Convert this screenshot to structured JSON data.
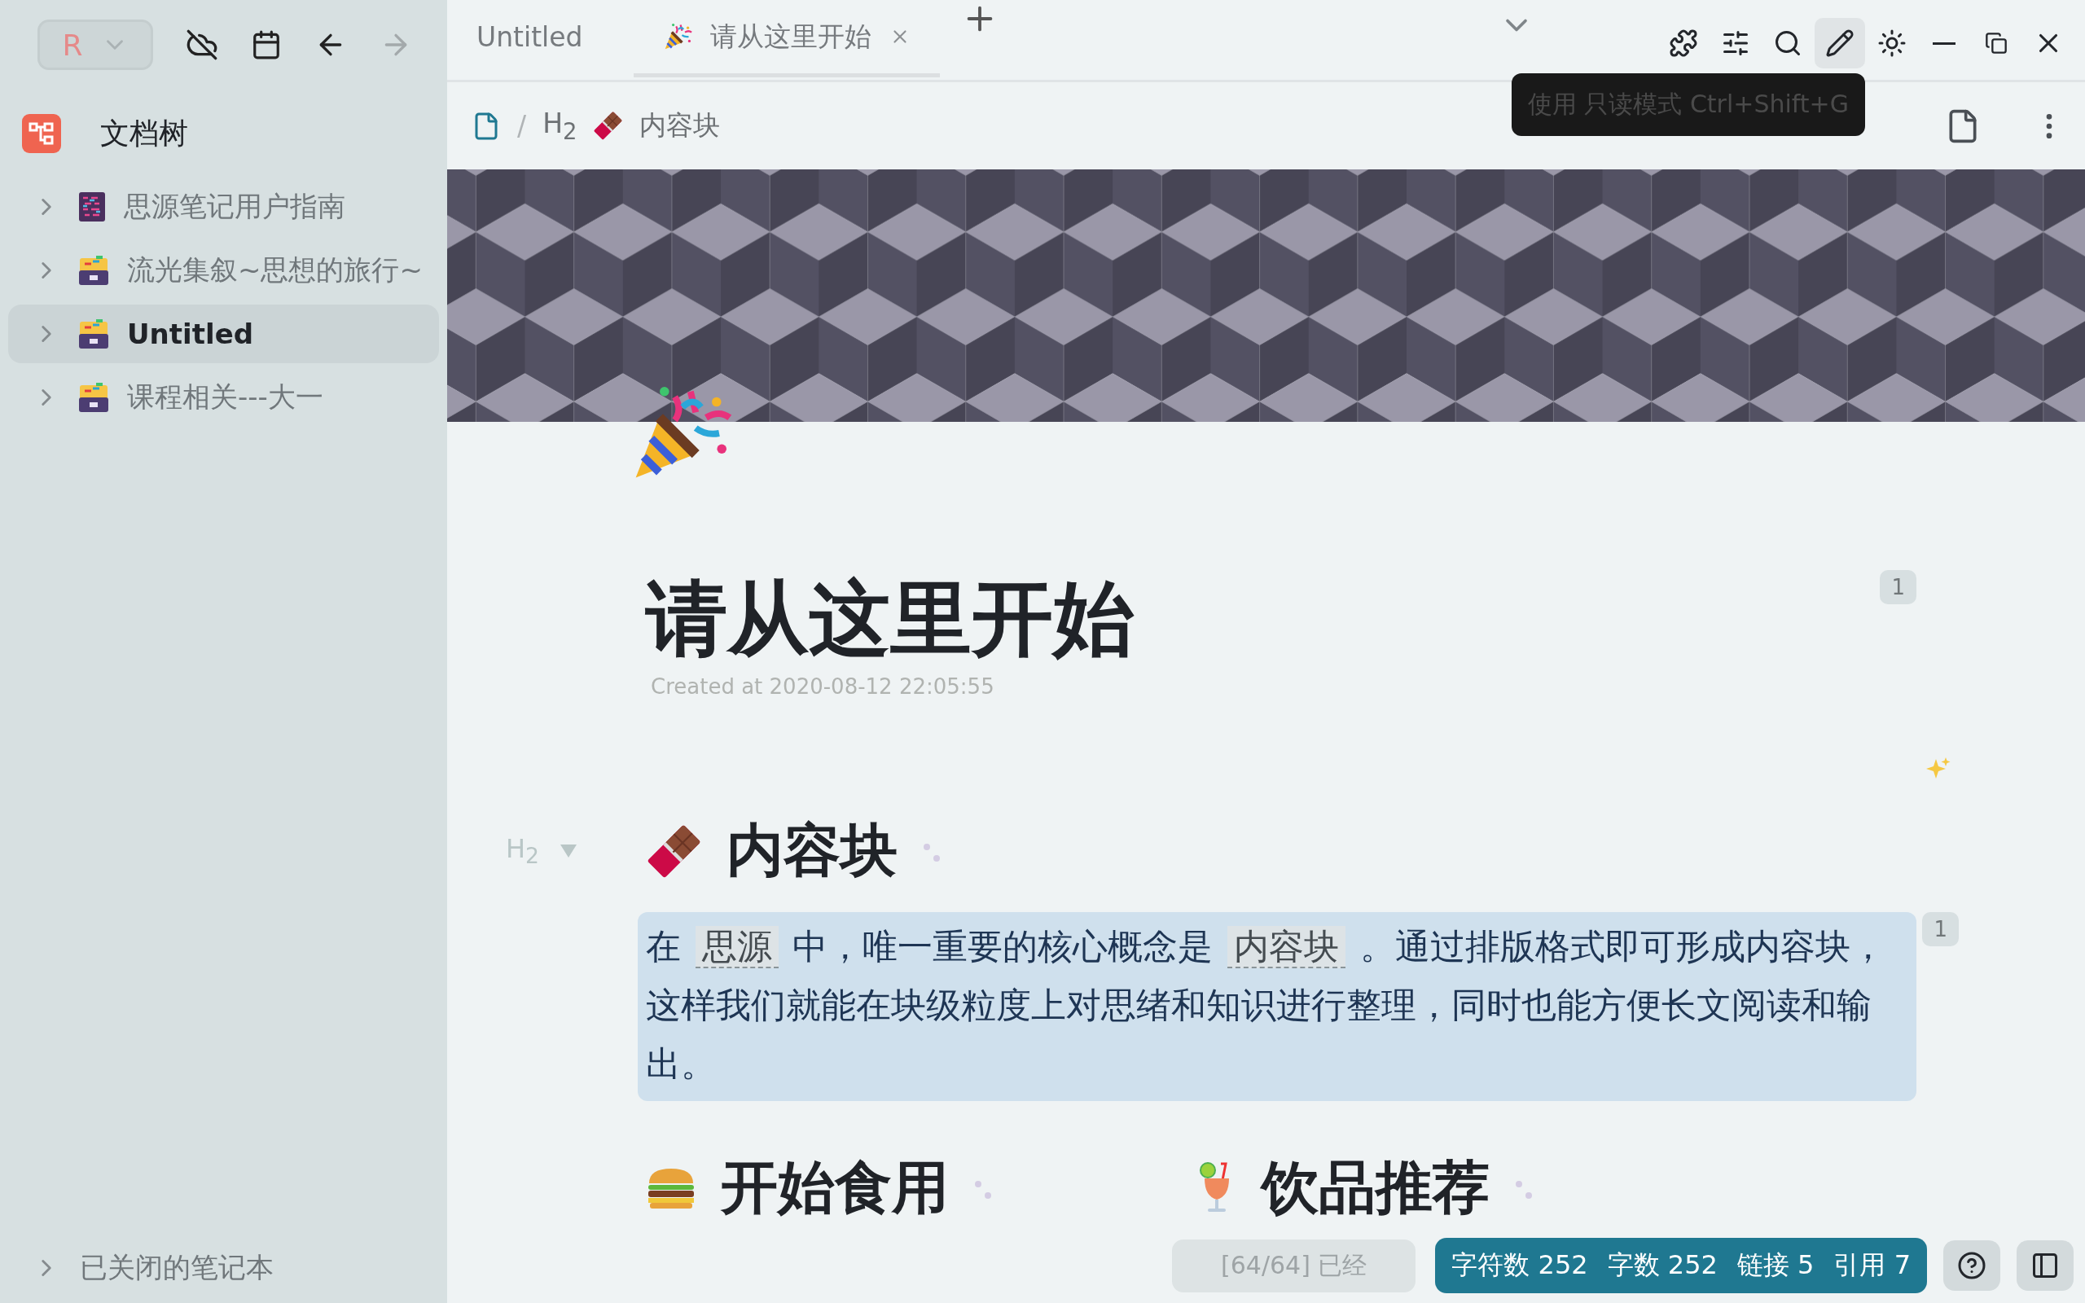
{
  "toolbar": {
    "workspace_initial": "R"
  },
  "sidebar": {
    "title": "文档树",
    "notebooks": [
      {
        "name": "思源笔记用户指南",
        "kind": "book",
        "selected": false
      },
      {
        "name": "流光集叙~思想的旅行~",
        "kind": "box",
        "selected": false
      },
      {
        "name": "Untitled",
        "kind": "box",
        "selected": true
      },
      {
        "name": "课程相关---大一",
        "kind": "box",
        "selected": false
      }
    ],
    "closed_notebooks": "已关闭的笔记本"
  },
  "tabs": [
    {
      "label": "Untitled",
      "selected": false
    },
    {
      "label": "请从这里开始",
      "selected": true
    }
  ],
  "top_buttons": [
    {
      "kind": "plugins",
      "highlighted": false
    },
    {
      "kind": "settings",
      "highlighted": false
    },
    {
      "kind": "search",
      "highlighted": false
    },
    {
      "kind": "edit",
      "highlighted": true
    },
    {
      "kind": "theme",
      "highlighted": false
    }
  ],
  "tooltip": "使用 只读模式 Ctrl+Shift+G",
  "breadcrumb": {
    "separator": "/",
    "level": "H$_{2}$",
    "block": "内容块"
  },
  "document": {
    "title": "请从这里开始",
    "created": "Created at 2020-08-12 22:05:55",
    "title_ref_count": "1",
    "heading": {
      "level": "H$_{2}$",
      "text": "内容块",
      "expanded": true
    },
    "paragraph": [
      {
        "kind": "text",
        "text": "在 "
      },
      {
        "kind": "ref",
        "text": "思源"
      },
      {
        "kind": "text",
        "text": " 中，唯一重要的核心概念是 "
      },
      {
        "kind": "ref",
        "text": "内容块"
      },
      {
        "kind": "text",
        "text": " 。通过排版格式即可形成内容块，这样我们就能在块级粒度上对思绪和知识进行整理，同时也能方便长文阅读和输出。"
      }
    ],
    "paragraph_ref_count": "1",
    "next_headings": [
      {
        "kind": "burger",
        "text": "开始食用"
      },
      {
        "kind": "drink",
        "text": "饮品推荐"
      }
    ]
  },
  "status": {
    "message": "[64/64] 已经",
    "counts": [
      "字符数 252",
      "字数 252",
      "链接 5",
      "引用 7"
    ]
  }
}
